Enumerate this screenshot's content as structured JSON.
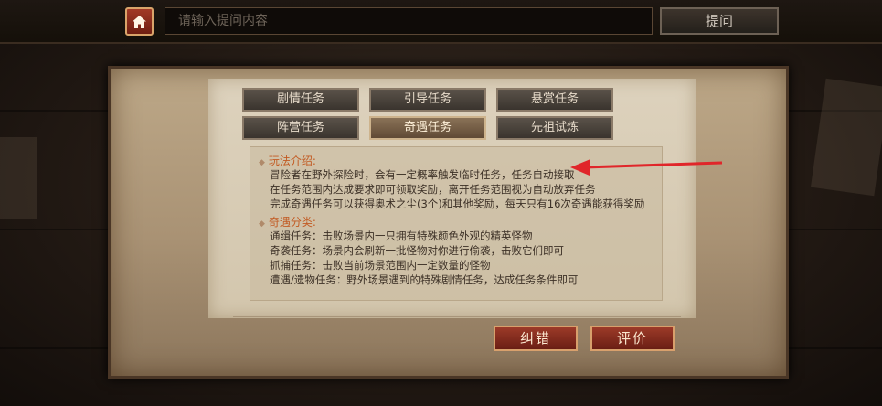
{
  "header": {
    "home_icon": "home-icon",
    "search_placeholder": "请输入提问内容",
    "ask_label": "提问"
  },
  "tabs": [
    {
      "label": "剧情任务",
      "active": false
    },
    {
      "label": "引导任务",
      "active": false
    },
    {
      "label": "悬赏任务",
      "active": false
    },
    {
      "label": "阵营任务",
      "active": false
    },
    {
      "label": "奇遇任务",
      "active": true
    },
    {
      "label": "先祖试炼",
      "active": false
    }
  ],
  "content": {
    "section1_title": "玩法介绍:",
    "section1_lines": [
      "冒险者在野外探险时，会有一定概率触发临时任务，任务自动接取",
      "在任务范围内达成要求即可领取奖励，离开任务范围视为自动放弃任务",
      "完成奇遇任务可以获得奥术之尘(3个)和其他奖励，每天只有16次奇遇能获得奖励"
    ],
    "section2_title": "奇遇分类:",
    "section2_lines": [
      "通缉任务：击败场景内一只拥有特殊颜色外观的精英怪物",
      "奇袭任务：场景内会刷新一批怪物对你进行偷袭，击败它们即可",
      "抓捕任务：击败当前场景范围内一定数量的怪物",
      "遭遇/遗物任务：野外场景遇到的特殊剧情任务，达成任务条件即可"
    ]
  },
  "footer": {
    "correct_label": "纠错",
    "rate_label": "评价"
  },
  "colors": {
    "accent_red": "#9c3a28",
    "section_title": "#c25a22",
    "annotation_arrow": "#e0262a"
  }
}
